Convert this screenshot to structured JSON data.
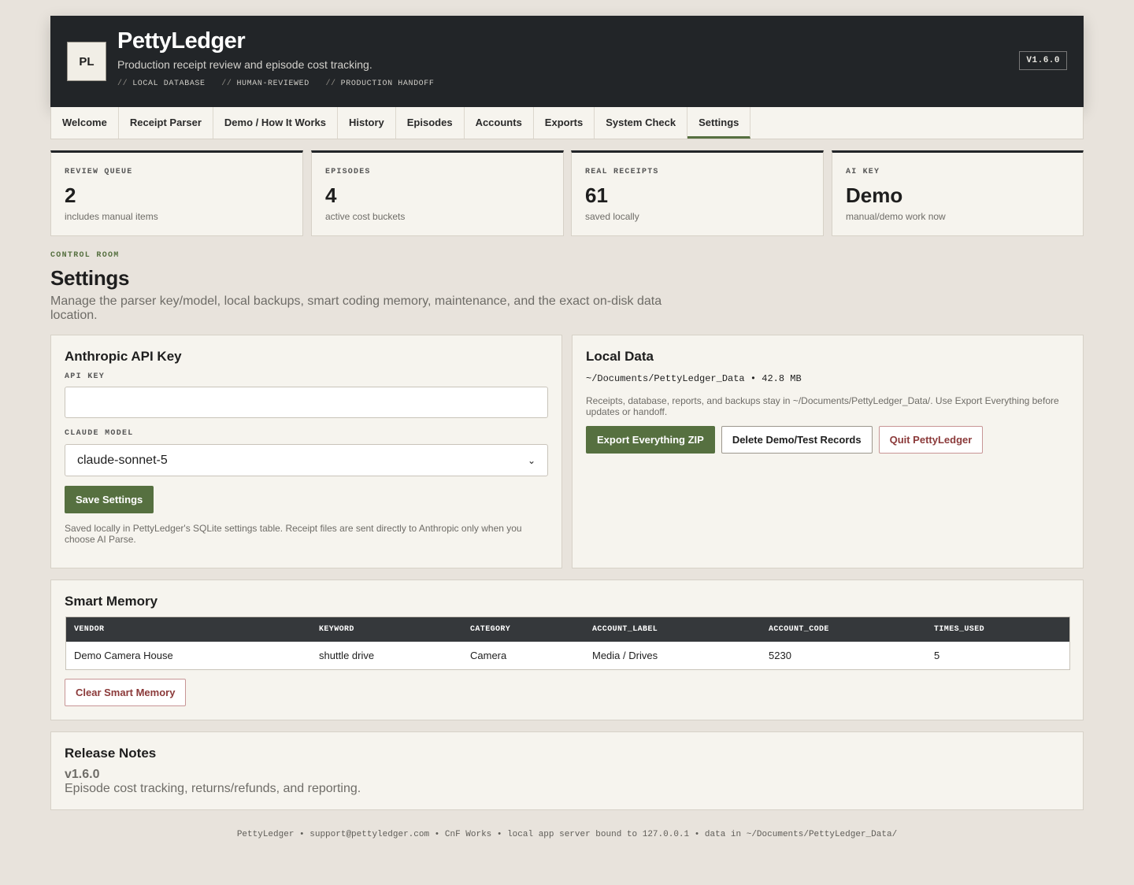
{
  "app": {
    "logo": "PL",
    "title": "PettyLedger",
    "subtitle": "Production receipt review and episode cost tracking.",
    "tags": [
      "LOCAL DATABASE",
      "HUMAN-REVIEWED",
      "PRODUCTION HANDOFF"
    ],
    "tag_prefix": "//",
    "version": "V1.6.0"
  },
  "nav": {
    "items": [
      "Welcome",
      "Receipt Parser",
      "Demo / How It Works",
      "History",
      "Episodes",
      "Accounts",
      "Exports",
      "System Check",
      "Settings"
    ],
    "active": "Settings"
  },
  "stats": [
    {
      "label": "REVIEW QUEUE",
      "value": "2",
      "note": "includes manual items"
    },
    {
      "label": "EPISODES",
      "value": "4",
      "note": "active cost buckets"
    },
    {
      "label": "REAL RECEIPTS",
      "value": "61",
      "note": "saved locally"
    },
    {
      "label": "AI KEY",
      "value": "Demo",
      "note": "manual/demo work now"
    }
  ],
  "page": {
    "eyebrow": "CONTROL ROOM",
    "title": "Settings",
    "description": "Manage the parser key/model, local backups, smart coding memory, maintenance, and the exact on-disk data location."
  },
  "api_panel": {
    "title": "Anthropic API Key",
    "api_key_label": "API KEY",
    "api_key_value": "",
    "model_label": "CLAUDE MODEL",
    "model_selected": "claude-sonnet-5",
    "save_label": "Save Settings",
    "help": "Saved locally in PettyLedger's SQLite settings table. Receipt files are sent directly to Anthropic only when you choose AI Parse."
  },
  "local_data": {
    "title": "Local Data",
    "path_info": "~/Documents/PettyLedger_Data • 42.8 MB",
    "description": "Receipts, database, reports, and backups stay in ~/Documents/PettyLedger_Data/. Use Export Everything before updates or handoff.",
    "export_label": "Export Everything ZIP",
    "delete_label": "Delete Demo/Test Records",
    "quit_label": "Quit PettyLedger"
  },
  "smart_memory": {
    "title": "Smart Memory",
    "columns": [
      "VENDOR",
      "KEYWORD",
      "CATEGORY",
      "ACCOUNT_LABEL",
      "ACCOUNT_CODE",
      "TIMES_USED"
    ],
    "rows": [
      [
        "Demo Camera House",
        "shuttle drive",
        "Camera",
        "Media / Drives",
        "5230",
        "5"
      ]
    ],
    "clear_label": "Clear Smart Memory"
  },
  "release_notes": {
    "title": "Release Notes",
    "version": "v1.6.0",
    "text": "Episode cost tracking, returns/refunds, and reporting."
  },
  "footer": "PettyLedger • support@pettyledger.com • CnF Works • local app server bound to 127.0.0.1 • data in ~/Documents/PettyLedger_Data/",
  "colors": {
    "accent": "#567040",
    "header_bg": "#222528",
    "page_bg": "#e8e3dc",
    "panel_bg": "#f6f4ee",
    "danger": "#8b3a3a"
  }
}
